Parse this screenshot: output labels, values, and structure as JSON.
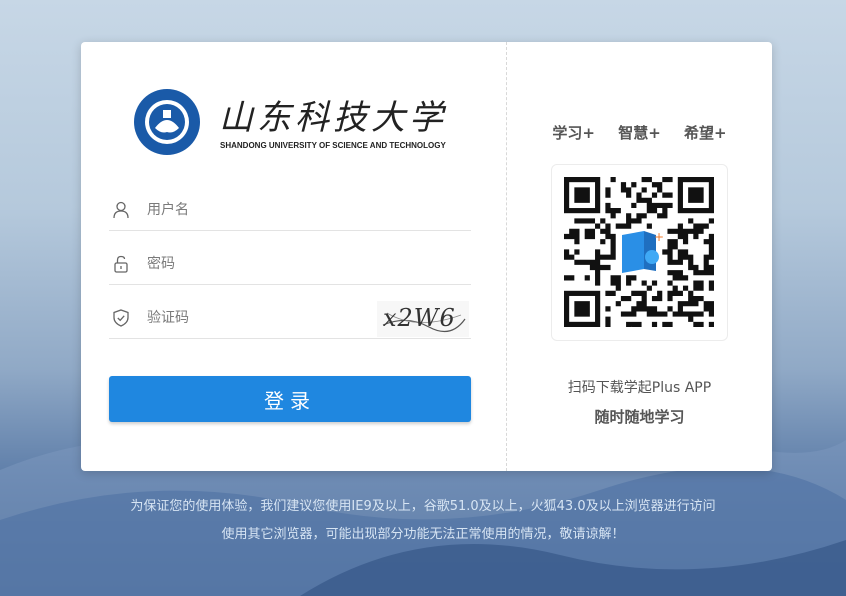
{
  "brand": {
    "name_cn": "山东科技大学",
    "name_en": "SHANDONG UNIVERSITY OF SCIENCE AND TECHNOLOGY"
  },
  "form": {
    "username_placeholder": "用户名",
    "password_placeholder": "密码",
    "captcha_placeholder": "验证码",
    "captcha_text": "x2W6",
    "login_label": "登录"
  },
  "side": {
    "slogans": [
      "学习+",
      "智慧+",
      "希望+"
    ],
    "scan_text": "扫码下载学起Plus APP",
    "anytime_text": "随时随地学习"
  },
  "footer": {
    "line1": "为保证您的使用体验，我们建议您使用IE9及以上，谷歌51.0及以上，火狐43.0及以上浏览器进行访问",
    "line2": "使用其它浏览器，可能出现部分功能无法正常使用的情况，敬请谅解！"
  },
  "colors": {
    "primary": "#1f87e0",
    "logo_blue": "#1a5aa8"
  },
  "icons": {
    "username": "user-icon",
    "password": "lock-icon",
    "captcha": "shield-icon",
    "app": "book-icon"
  }
}
